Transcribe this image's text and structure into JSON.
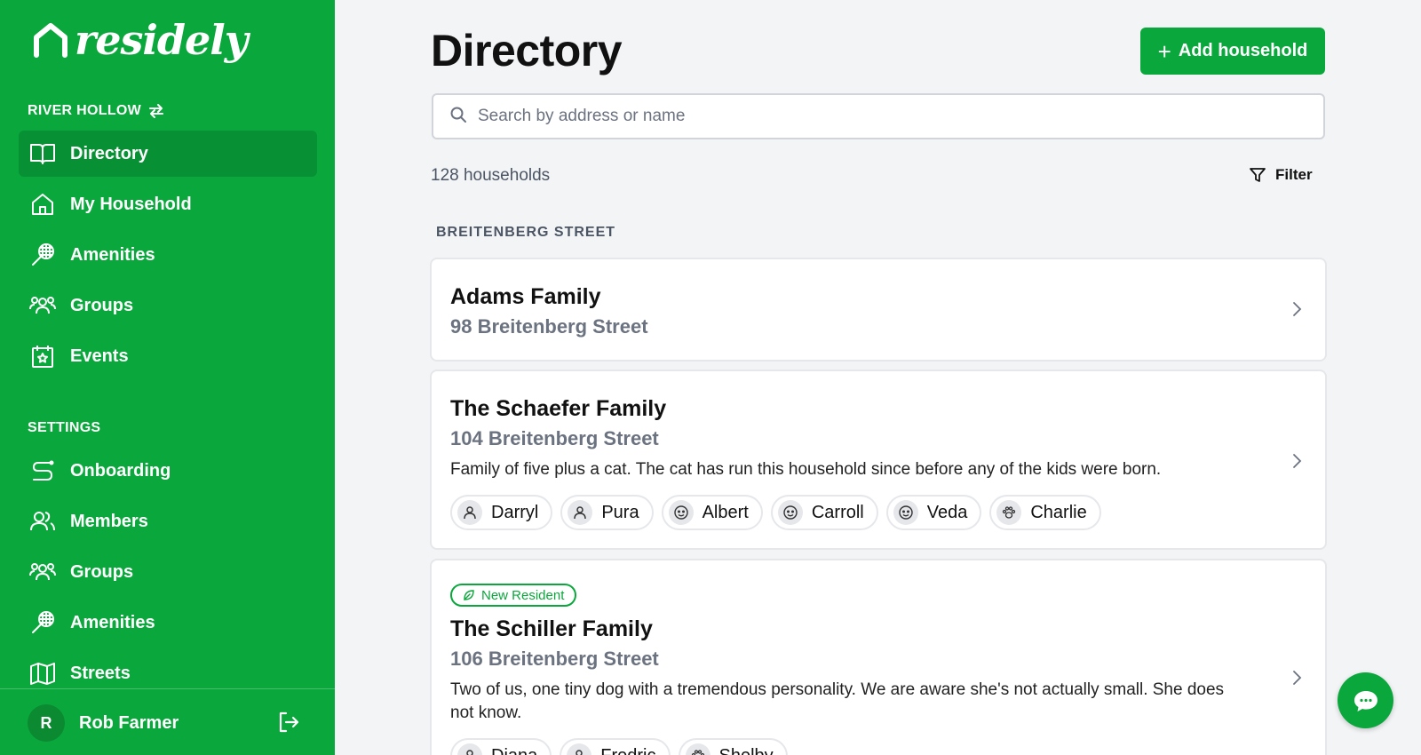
{
  "app": {
    "name": "residely",
    "brand_color": "#0aa83c"
  },
  "sidebar": {
    "community": "RIVER HOLLOW",
    "items": [
      {
        "label": "Directory",
        "icon": "book-open-icon",
        "active": true
      },
      {
        "label": "My Household",
        "icon": "home-icon"
      },
      {
        "label": "Amenities",
        "icon": "tennis-racket-icon"
      },
      {
        "label": "Groups",
        "icon": "users-icon"
      },
      {
        "label": "Events",
        "icon": "calendar-star-icon"
      }
    ],
    "settings_label": "SETTINGS",
    "settings_items": [
      {
        "label": "Onboarding",
        "icon": "route-icon"
      },
      {
        "label": "Members",
        "icon": "members-icon"
      },
      {
        "label": "Groups",
        "icon": "users-icon"
      },
      {
        "label": "Amenities",
        "icon": "tennis-racket-icon"
      },
      {
        "label": "Streets",
        "icon": "map-icon"
      }
    ],
    "user": {
      "initial": "R",
      "name": "Rob Farmer"
    }
  },
  "main": {
    "title": "Directory",
    "add_button": "Add household",
    "search_placeholder": "Search by address or name",
    "count": "128 households",
    "filter": "Filter",
    "street": "BREITENBERG STREET",
    "households": [
      {
        "name": "Adams Family",
        "address": "98 Breitenberg Street"
      },
      {
        "name": "The Schaefer Family",
        "address": "104 Breitenberg Street",
        "description": "Family of five plus a cat. The cat has run this household since before any of the kids were born.",
        "members": [
          {
            "name": "Darryl",
            "icon": "person-icon"
          },
          {
            "name": "Pura",
            "icon": "person-icon"
          },
          {
            "name": "Albert",
            "icon": "child-face-icon"
          },
          {
            "name": "Carroll",
            "icon": "child-face-icon"
          },
          {
            "name": "Veda",
            "icon": "child-face-icon"
          },
          {
            "name": "Charlie",
            "icon": "paw-icon"
          }
        ]
      },
      {
        "badge": "New Resident",
        "name": "The Schiller Family",
        "address": "106 Breitenberg Street",
        "description": "Two of us, one tiny dog with a tremendous personality. We are aware she's not actually small. She does not know.",
        "members": [
          {
            "name": "Diana",
            "icon": "person-icon"
          },
          {
            "name": "Fredric",
            "icon": "person-icon"
          },
          {
            "name": "Shelby",
            "icon": "paw-icon"
          }
        ]
      }
    ]
  }
}
